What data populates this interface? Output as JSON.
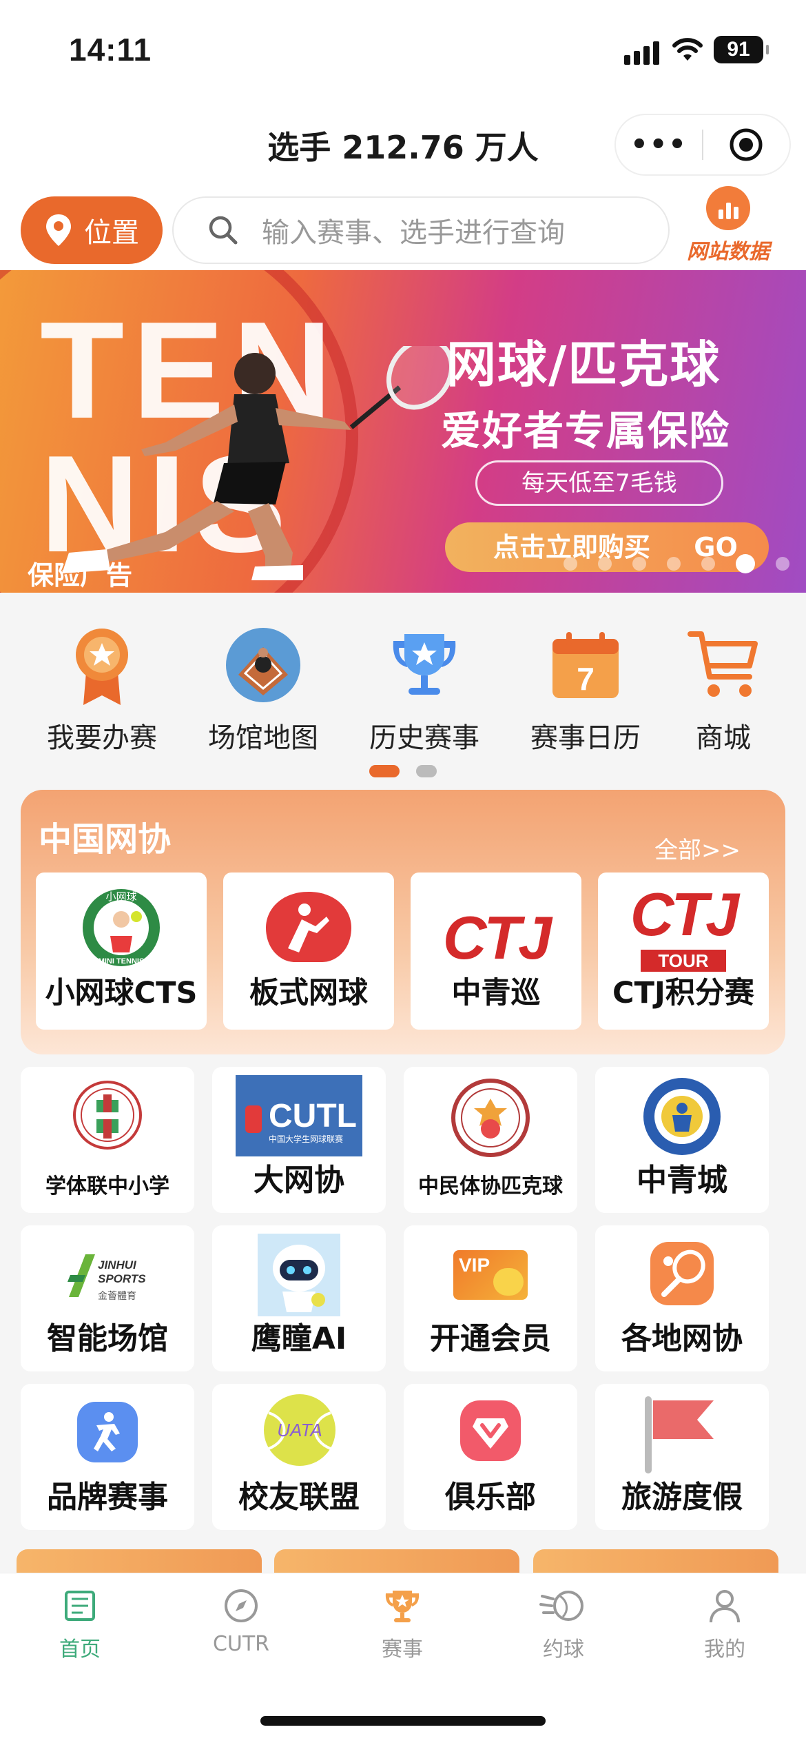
{
  "status_bar": {
    "time": "14:11",
    "battery": "91"
  },
  "nav": {
    "title": "选手 212.76 万人",
    "more": "•••"
  },
  "search": {
    "location_label": "位置",
    "placeholder": "输入赛事、选手进行查询",
    "site_data_label": "网站数据"
  },
  "banner": {
    "big_text": [
      "TEN",
      "NIS"
    ],
    "headline": "网球/匹克球",
    "subheadline": "爱好者专属保险",
    "price_note": "每天低至7毛钱",
    "buy_button": "点击立即购买",
    "go": "GO",
    "tag": "保险广告",
    "slides": 7,
    "active_slide": 6
  },
  "quick_menu": {
    "items": [
      {
        "label": "我要办赛",
        "icon": "medal-icon"
      },
      {
        "label": "场馆地图",
        "icon": "tennis-court-icon"
      },
      {
        "label": "历史赛事",
        "icon": "trophy-icon"
      },
      {
        "label": "赛事日历",
        "icon": "calendar-icon",
        "day": "7"
      },
      {
        "label": "商城",
        "icon": "cart-icon"
      }
    ],
    "pages": 2,
    "active_page": 1
  },
  "cta": {
    "title": "中国网协",
    "all_link": "全部>>",
    "cards": [
      {
        "label": "小网球CTS",
        "logo_text": "MINI TENNIS",
        "logo_top": "小网球"
      },
      {
        "label": "板式网球"
      },
      {
        "label": "中青巡",
        "logo_text": "CTJ"
      },
      {
        "label": "CTJ积分赛",
        "logo_text": "CTJ",
        "logo_sub": "TOUR"
      }
    ]
  },
  "grid": {
    "row1": [
      {
        "label": "学体联中小学"
      },
      {
        "label": "大网协",
        "logo_text": "CUTL",
        "logo_sub": "中国大学生网球联赛"
      },
      {
        "label": "中民体协匹克球"
      },
      {
        "label": "中青城"
      }
    ],
    "row2": [
      {
        "label": "智能场馆",
        "logo_text": "JINHUI SPORTS",
        "logo_sub": "金薈體育"
      },
      {
        "label": "鹰瞳AI"
      },
      {
        "label": "开通会员",
        "logo_text": "VIP"
      },
      {
        "label": "各地网协"
      }
    ],
    "row3": [
      {
        "label": "品牌赛事"
      },
      {
        "label": "校友联盟",
        "logo_text": "UATA"
      },
      {
        "label": "俱乐部"
      },
      {
        "label": "旅游度假"
      }
    ]
  },
  "tabbar": {
    "tabs": [
      {
        "label": "首页",
        "active": true
      },
      {
        "label": "CUTR"
      },
      {
        "label": "赛事"
      },
      {
        "label": "约球"
      },
      {
        "label": "我的"
      }
    ]
  },
  "colors": {
    "accent": "#e9692c",
    "active_tab": "#3daa7a",
    "ctj_red": "#d42a2a"
  }
}
